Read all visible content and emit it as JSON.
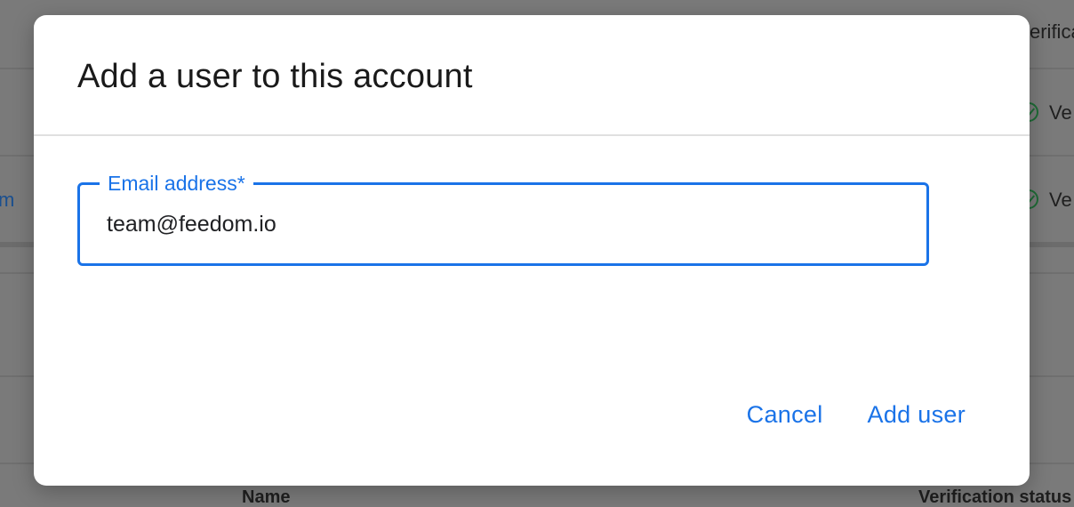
{
  "background": {
    "header_partial": "erifica",
    "row_link_partial": "m",
    "verified_partial_1": "Ve",
    "verified_partial_2": "Ve",
    "column_name": "Name",
    "column_verification": "Verification status"
  },
  "dialog": {
    "title": "Add a user to this account",
    "email_field": {
      "label": "Email address*",
      "value": "team@feedom.io"
    },
    "cancel_label": "Cancel",
    "add_user_label": "Add user"
  },
  "colors": {
    "accent": "#1a73e8",
    "backdrop": "#7a7a7a",
    "check": "#1e6b36"
  }
}
